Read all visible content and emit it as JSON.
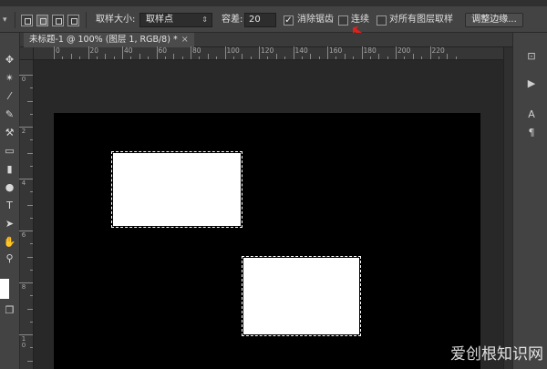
{
  "options_bar": {
    "sample_size_label": "取样大小:",
    "sample_size_value": "取样点",
    "tolerance_label": "容差:",
    "tolerance_value": "20",
    "antialias_label": "消除锯齿",
    "antialias_checked": true,
    "contiguous_label": "连续",
    "contiguous_checked": false,
    "sample_all_layers_label": "对所有图层取样",
    "sample_all_layers_checked": false,
    "refine_edge_label": "调整边缘..."
  },
  "document_tab": {
    "title": "未标题-1 @ 100% (图层 1, RGB/8) *",
    "close": "×"
  },
  "rulers": {
    "horizontal_labels": [
      "0",
      "20",
      "40",
      "60",
      "80",
      "100",
      "120",
      "140",
      "160",
      "180",
      "200",
      "220"
    ],
    "vertical_labels": [
      "0",
      "2",
      "4",
      "6",
      "8",
      "10"
    ]
  },
  "canvas": {
    "background": "#000000",
    "shapes": [
      "white-rectangle-selected",
      "white-rectangle-selected"
    ]
  },
  "annotation": {
    "arrow_color": "#e0201b",
    "points_to": "contiguous-checkbox"
  },
  "watermark": {
    "text": "爱创根知识网"
  },
  "icons": {
    "left_tools": [
      "move-icon",
      "magic-wand-icon",
      "eyedropper-icon",
      "brush-icon",
      "stamp-icon",
      "eraser-icon",
      "gradient-icon",
      "pen-icon",
      "text-icon",
      "path-select-icon",
      "hand-icon",
      "zoom-icon",
      "color-swatch",
      "screen-mode-icon"
    ],
    "right_panel": [
      "history-icon",
      "actions-icon",
      "character-icon",
      "paragraph-icon"
    ]
  }
}
